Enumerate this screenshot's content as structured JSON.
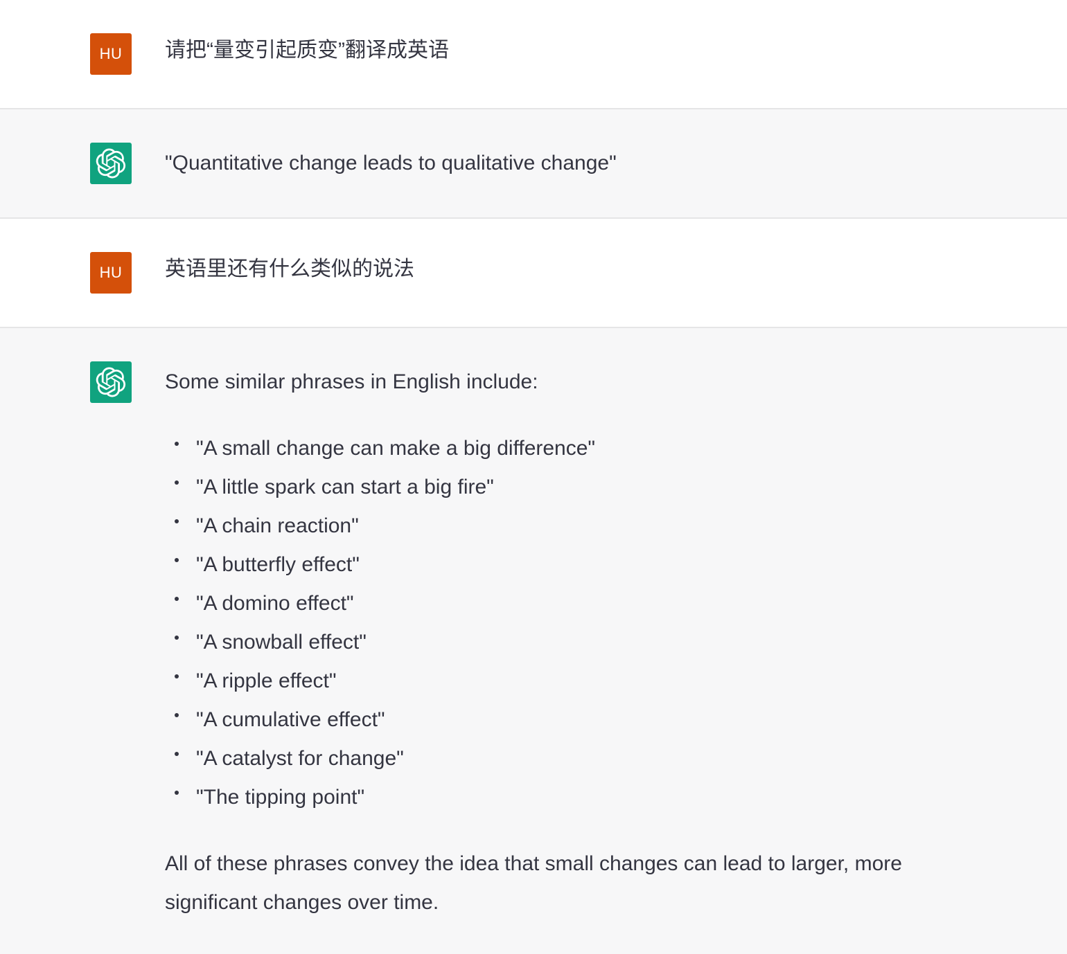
{
  "conversation": {
    "turn1": {
      "avatar_label": "HU",
      "text": "请把“量变引起质变”翻译成英语"
    },
    "turn2": {
      "avatar_icon": "openai-logo-icon",
      "text": "\"Quantitative change leads to qualitative change\""
    },
    "turn3": {
      "avatar_label": "HU",
      "text": "英语里还有什么类似的说法"
    },
    "turn4": {
      "avatar_icon": "openai-logo-icon",
      "intro": "Some similar phrases in English include:",
      "items": [
        "\"A small change can make a big difference\"",
        "\"A little spark can start a big fire\"",
        "\"A chain reaction\"",
        "\"A butterfly effect\"",
        "\"A domino effect\"",
        "\"A snowball effect\"",
        "\"A ripple effect\"",
        "\"A cumulative effect\"",
        "\"A catalyst for change\"",
        "\"The tipping point\""
      ],
      "outro": "All of these phrases convey the idea that small changes can lead to larger, more significant changes over time."
    }
  },
  "colors": {
    "user_avatar": "#d4500a",
    "assistant_avatar": "#10a37f",
    "assistant_bg": "#f7f7f8",
    "text": "#343541"
  }
}
